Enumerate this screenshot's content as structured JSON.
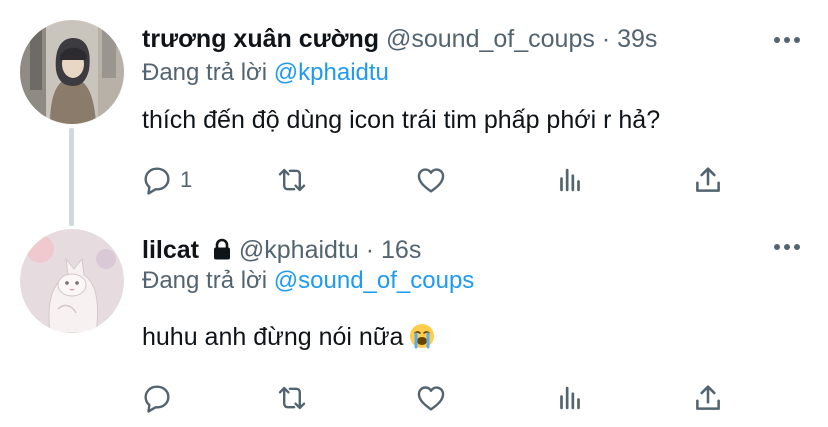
{
  "thread": [
    {
      "author": {
        "name": "trương xuân cường",
        "handle": "@sound_of_coups",
        "locked": false
      },
      "time": "39s",
      "separator": "·",
      "reply_prefix": "Đang trả lời",
      "reply_to": "@kphaidtu",
      "text": "thích đến độ dùng icon trái tim phấp phới r hả?",
      "reply_count": "1",
      "icons": [
        "reply-icon",
        "retweet-icon",
        "like-icon",
        "stats-icon",
        "share-icon",
        "more-icon"
      ]
    },
    {
      "author": {
        "name": "lilcat",
        "handle": "@kphaidtu",
        "locked": true
      },
      "time": "16s",
      "separator": "·",
      "reply_prefix": "Đang trả lời",
      "reply_to": "@sound_of_coups",
      "text": "huhu anh đừng nói nữa",
      "emoji": "loudly-crying-face",
      "reply_count": "",
      "icons": [
        "reply-icon",
        "retweet-icon",
        "like-icon",
        "stats-icon",
        "share-icon",
        "more-icon",
        "lock-icon"
      ]
    }
  ],
  "colors": {
    "text": "#0f1419",
    "secondary": "#536471",
    "link": "#1d9bf0",
    "thread_line": "#cfd9de"
  }
}
